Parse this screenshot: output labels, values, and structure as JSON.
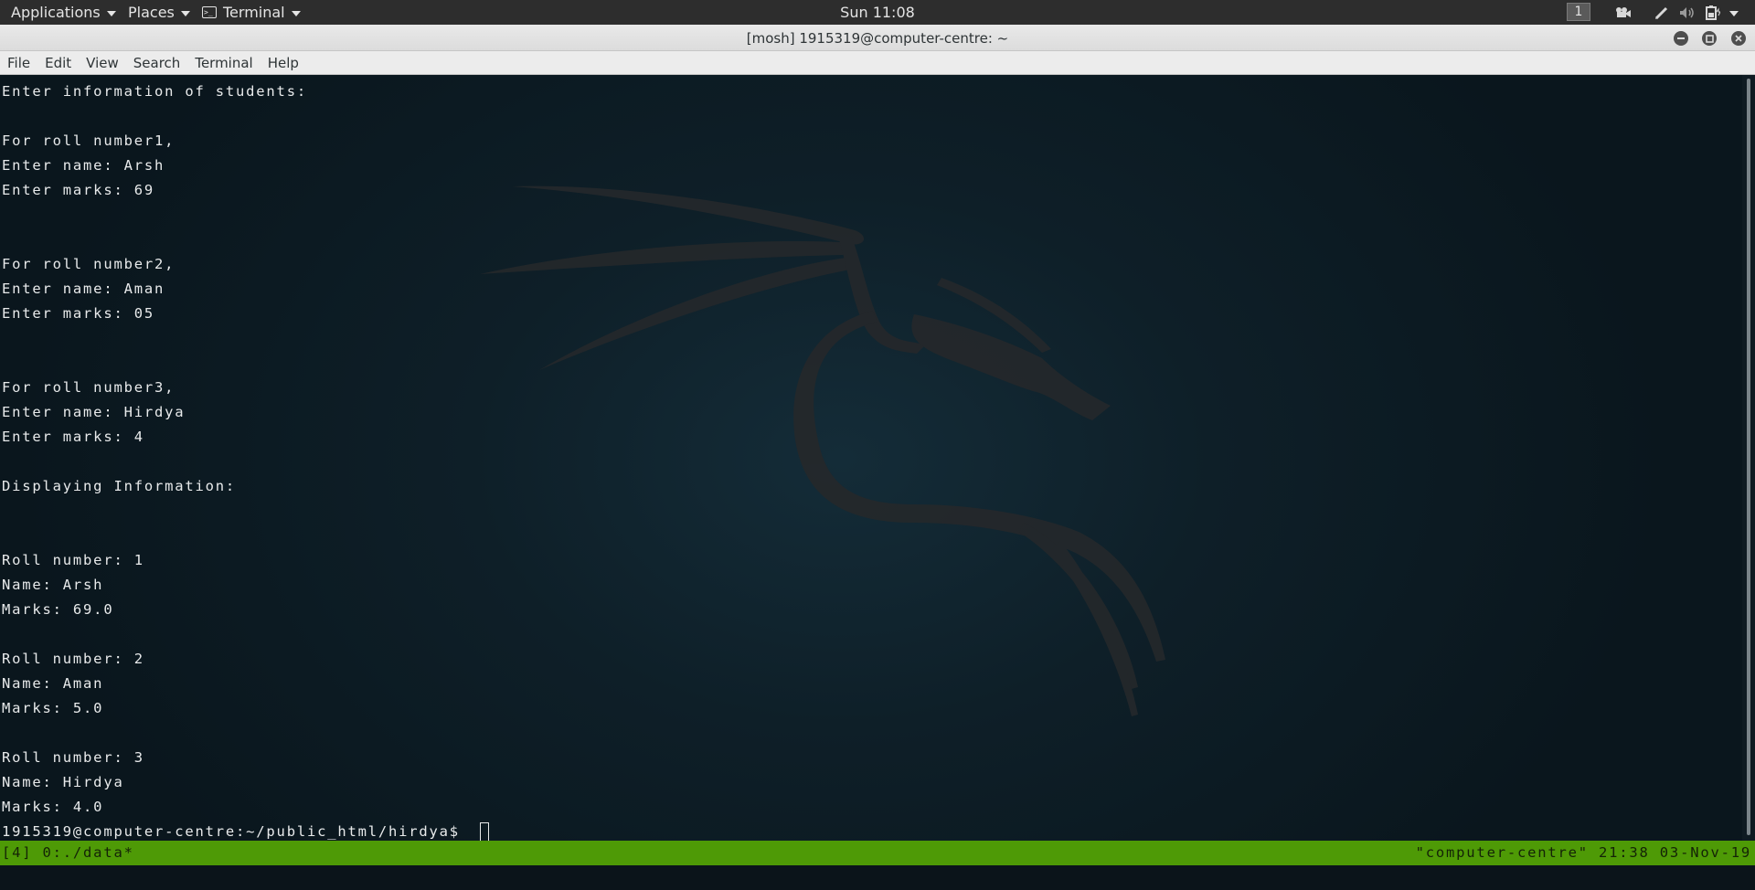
{
  "topbar": {
    "applications_label": "Applications",
    "places_label": "Places",
    "terminal_label": "Terminal",
    "clock": "Sun 11:08",
    "workspace": "1"
  },
  "window": {
    "title": "[mosh] 1915319@computer-centre: ~"
  },
  "menubar": {
    "file": "File",
    "edit": "Edit",
    "view": "View",
    "search": "Search",
    "terminal": "Terminal",
    "help": "Help"
  },
  "terminal": {
    "lines": [
      "Enter information of students:",
      "",
      "For roll number1,",
      "Enter name: Arsh",
      "Enter marks: 69",
      "",
      "",
      "For roll number2,",
      "Enter name: Aman",
      "Enter marks: 05",
      "",
      "",
      "For roll number3,",
      "Enter name: Hirdya",
      "Enter marks: 4",
      "",
      "Displaying Information:",
      "",
      "",
      "Roll number: 1",
      "Name: Arsh",
      "Marks: 69.0",
      "",
      "Roll number: 2",
      "Name: Aman",
      "Marks: 5.0",
      "",
      "Roll number: 3",
      "Name: Hirdya",
      "Marks: 4.0"
    ],
    "prompt": "1915319@computer-centre:~/public_html/hirdya$ "
  },
  "status_bar": {
    "left": "[4] 0:./data*",
    "right": "\"computer-centre\" 21:38 03-Nov-19"
  },
  "colors": {
    "status_green": "#4e9a06",
    "terminal_text": "#e8eaeb"
  }
}
